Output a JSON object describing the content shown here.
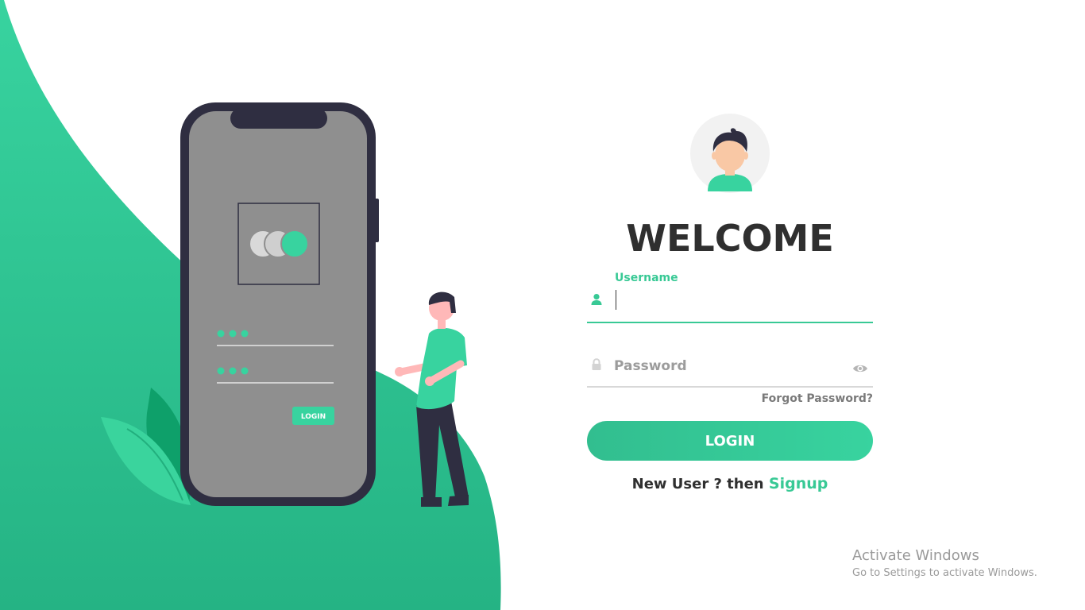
{
  "colors": {
    "accent": "#38c995",
    "accent_dark": "#32be8f",
    "wave_top": "#38d39f",
    "wave_bottom": "#25b384",
    "phone_frame": "#2f2e41",
    "phone_screen": "#8f8f8f",
    "heading": "#2f2f2f"
  },
  "icons": {
    "avatar": "user-avatar-icon",
    "username": "user-icon",
    "password": "lock-icon",
    "toggle_password": "eye-icon"
  },
  "illustration": {
    "phone_login_button_label": "LOGIN"
  },
  "login": {
    "heading": "WELCOME",
    "username": {
      "label": "Username",
      "value": ""
    },
    "password": {
      "placeholder": "Password",
      "value": ""
    },
    "forgot_password": "Forgot Password?",
    "submit_label": "LOGIN",
    "signup_prompt": "New User ? then",
    "signup_link": "Signup"
  },
  "watermark": {
    "title": "Activate Windows",
    "subtitle": "Go to Settings to activate Windows."
  }
}
